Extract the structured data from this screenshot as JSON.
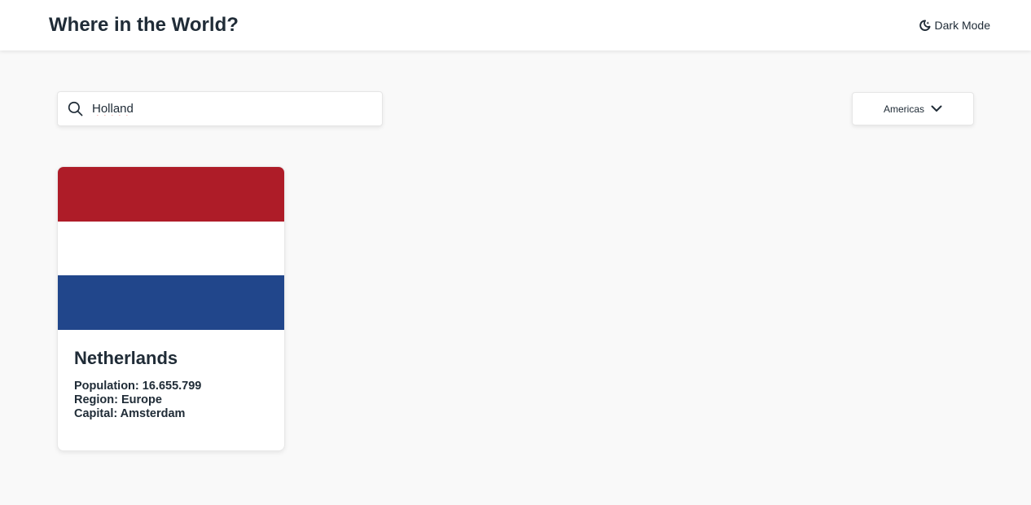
{
  "header": {
    "title": "Where in the World?",
    "theme_toggle_label": "Dark Mode",
    "theme_toggle_icon": "moon-icon"
  },
  "search": {
    "icon": "search-icon",
    "value": "Holland"
  },
  "filter": {
    "selected": "Americas",
    "icon": "chevron-down-icon"
  },
  "countries": [
    {
      "name": "Netherlands",
      "flag_colors": [
        "#ae1c28",
        "#ffffff",
        "#21468b"
      ],
      "population_label": "Population:",
      "population": "16.655.799",
      "region_label": "Region:",
      "region": "Europe",
      "capital_label": "Capital:",
      "capital": "Amsterdam"
    }
  ]
}
